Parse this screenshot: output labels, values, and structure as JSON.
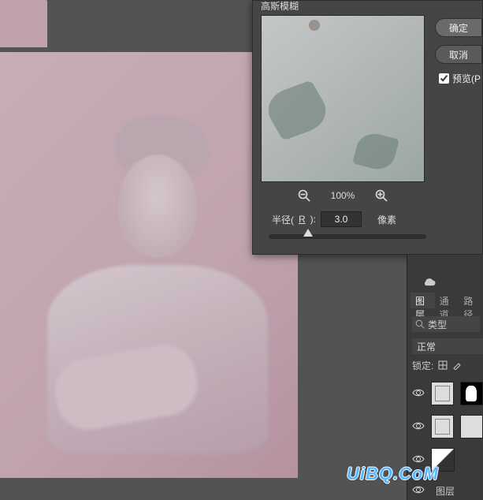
{
  "dialog": {
    "title": "高斯模糊",
    "ok_label": "确定",
    "cancel_label": "取消",
    "preview_label": "预览(P",
    "zoom_level": "100%",
    "radius_label_prefix": "半径(",
    "radius_hotkey": "R",
    "radius_label_suffix": "):",
    "radius_value": "3.0",
    "unit_label": "像素"
  },
  "panels": {
    "tabs": {
      "layers": "图层",
      "channels": "通道",
      "paths": "路径"
    },
    "filter_kind": "类型",
    "blend_mode": "正常",
    "lock_label": "锁定:",
    "bottom_label": "图层"
  },
  "watermark": "UiBQ.CoM"
}
